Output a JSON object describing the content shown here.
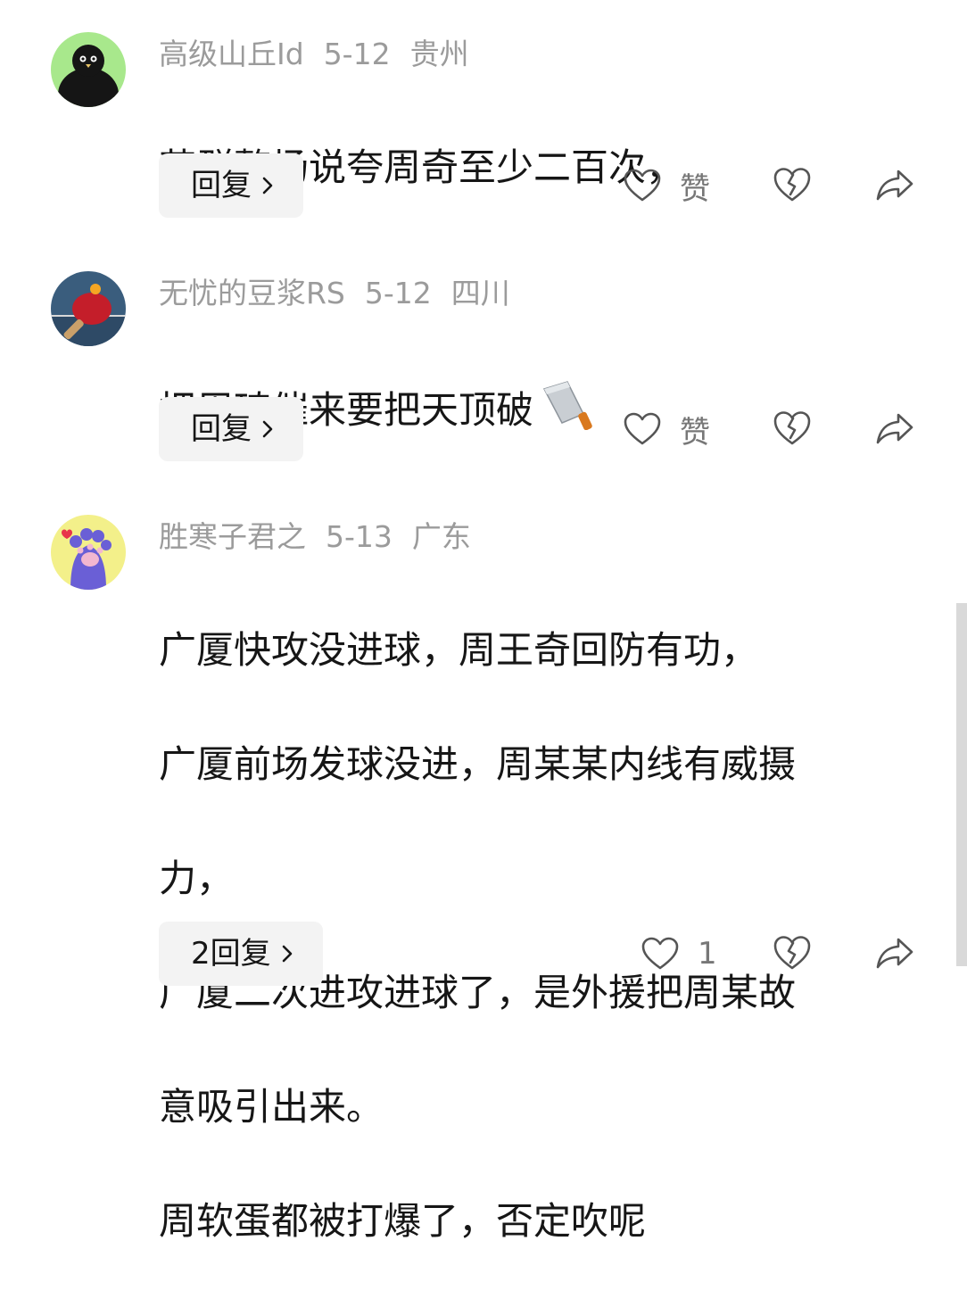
{
  "comments": [
    {
      "username": "高级山丘Id",
      "date": "5-12",
      "location": "贵州",
      "lines": [
        "苏群整场说夸周奇至少二百次，"
      ],
      "reply_label": "回复",
      "like_label": "赞",
      "avatar": "black-bird-avatar"
    },
    {
      "username": "无忧的豆浆RS",
      "date": "5-12",
      "location": "四川",
      "lines": [
        "把周琦催来要把天顶破"
      ],
      "reply_label": "回复",
      "like_label": "赞",
      "avatar": "ping-pong-paddle-avatar",
      "emoji": "kitchen-knife-emoji"
    },
    {
      "username": "胜寒子君之",
      "date": "5-13",
      "location": "广东",
      "lines": [
        "广厦快攻没进球，周王奇回防有功，",
        "广厦前场发球没进，周某某内线有威摄",
        "力，",
        "广厦二次进攻进球了，是外援把周某故",
        "意吸引出来。",
        "周软蛋都被打爆了，否定吹呢"
      ],
      "reply_label": "2回复",
      "like_label": "1",
      "avatar": "cat-paw-avatar"
    }
  ],
  "icons": [
    "heart-icon",
    "broken-heart-icon",
    "share-arrow-icon",
    "chevron-right-icon"
  ],
  "colors": {
    "text": "#161616",
    "meta": "#9b9b9b",
    "icon": "#555555",
    "reply_bg": "#f3f3f3"
  }
}
